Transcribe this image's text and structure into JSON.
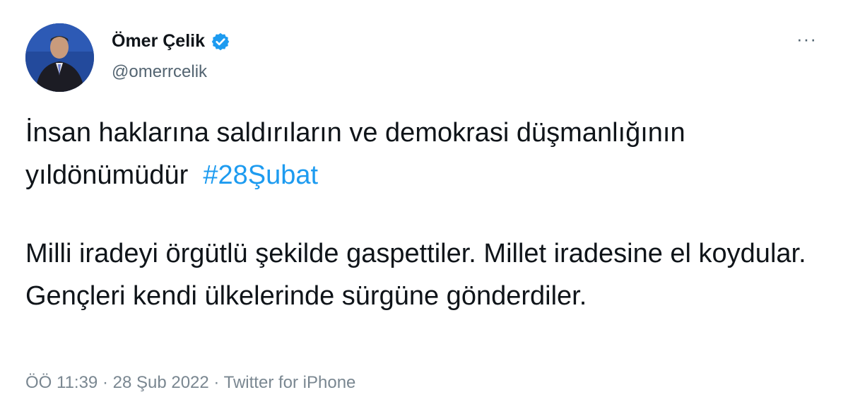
{
  "tweet": {
    "author": {
      "display_name": "Ömer Çelik",
      "handle": "@omerrcelik",
      "verified": true,
      "avatar_icon": "profile-photo"
    },
    "more_label": "···",
    "paragraph1": {
      "text": "İnsan haklarına saldırıların ve demokrasi düşmanlığının yıldönümüdür",
      "hashtag": "#28Şubat"
    },
    "paragraph2": "Milli iradeyi örgütlü şekilde gaspettiler. Millet iradesine el koydular. Gençleri kendi ülkelerinde sürgüne gönderdiler.",
    "meta": {
      "time": "ÖÖ 11:39",
      "separator": " · ",
      "date": "28 Şub 2022",
      "source": "Twitter for iPhone"
    },
    "colors": {
      "link": "#1d9bf0",
      "text": "#0f1419",
      "secondary": "#536471"
    }
  }
}
